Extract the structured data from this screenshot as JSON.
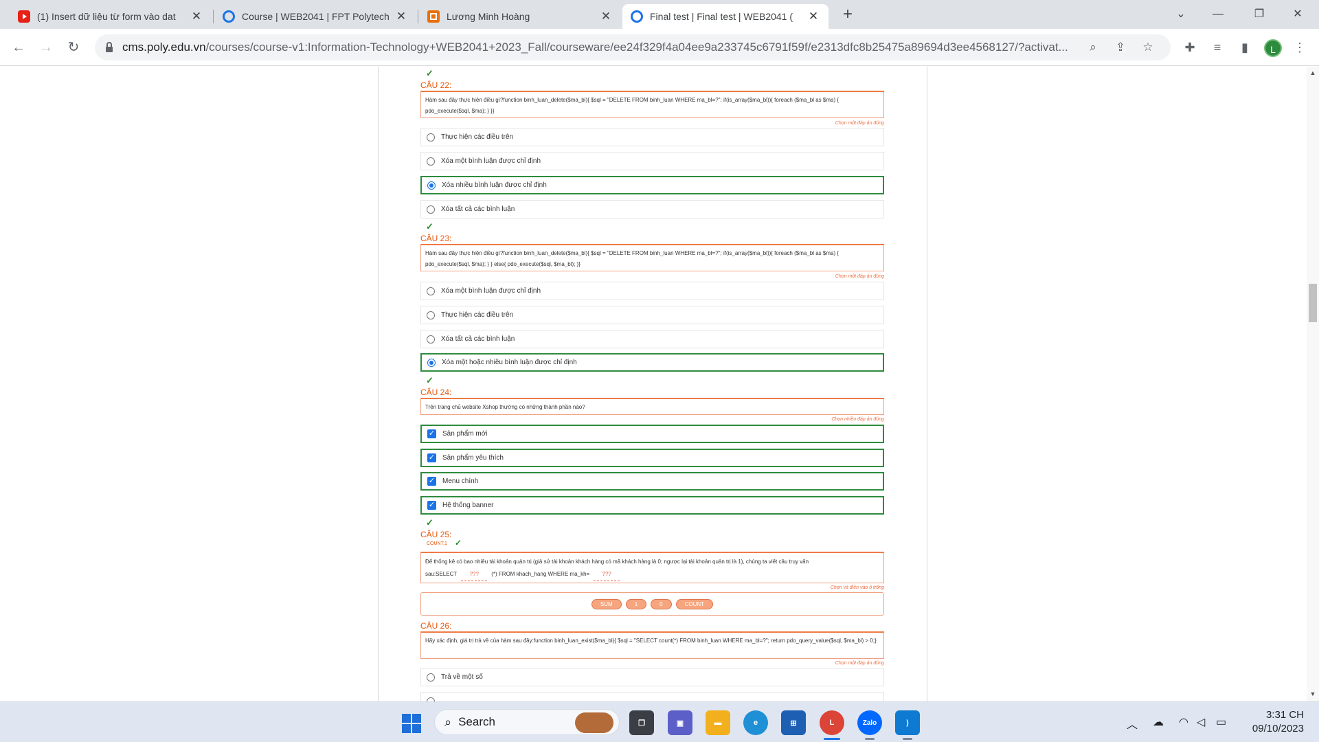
{
  "browser": {
    "tabs": [
      {
        "title": "(1) Insert dữ liệu từ form vào dat",
        "favicon": "youtube-icon"
      },
      {
        "title": "Course | WEB2041 | FPT Polytech",
        "favicon": "course-ring-icon"
      },
      {
        "title": "Lương Minh Hoàng",
        "favicon": "box-icon"
      },
      {
        "title": "Final test | Final test | WEB2041 (",
        "favicon": "course-ring-icon"
      }
    ],
    "url_host": "cms.poly.edu.vn",
    "url_path": "/courses/course-v1:Information-Technology+WEB2041+2023_Fall/courseware/ee24f329f4a04ee9a233745c6791f59f/e2313dfc8b25475a89694d3ee4568127/?activat...",
    "profile_initial": "L"
  },
  "quiz": {
    "q22": {
      "title": "CÂU 22:",
      "text": "Hàm sau đây thực hiện điều gì?function binh_luan_delete($ma_bl){ $sql = \"DELETE FROM binh_luan WHERE ma_bl=?\"; if(is_array($ma_bl)){ foreach ($ma_bl as $ma) { pdo_execute($sql, $ma); } }}",
      "hint": "Chọn một đáp án đúng",
      "options": [
        "Thực hiện các điều trên",
        "Xóa một bình luận được chỉ định",
        "Xóa nhiều bình luận được chỉ định",
        "Xóa tất cả các bình luận"
      ],
      "selected": 2
    },
    "q23": {
      "title": "CÂU 23:",
      "text": "Hàm sau đây thực hiện điều gì?function binh_luan_delete($ma_bl){ $sql = \"DELETE FROM binh_luan WHERE ma_bl=?\"; if(is_array($ma_bl)){ foreach ($ma_bl as $ma) { pdo_execute($sql, $ma); } } else{ pdo_execute($sql, $ma_bl); }}",
      "hint": "Chọn một đáp án đúng",
      "options": [
        "Xóa một bình luận được chỉ định",
        "Thực hiện các điều trên",
        "Xóa tất cả các bình luận",
        "Xóa một hoặc nhiều bình luận được chỉ định"
      ],
      "selected": 3
    },
    "q24": {
      "title": "CÂU 24:",
      "text": "Trên trang chủ website Xshop thường có những thành phần nào?",
      "hint": "Chọn nhiều đáp án đúng",
      "options": [
        "Sản phẩm mới",
        "Sản phẩm yêu thích",
        "Menu chính",
        "Hệ thống banner"
      ]
    },
    "q25": {
      "title": "CÂU 25:",
      "answered": "COUNT,1",
      "text_a": "Để thống kê có bao nhiêu tài khoản quản trị (giả sử tài khoản khách hàng có mã khách hàng là 0; ngược lại tài khoản quản trị là 1), chúng ta viết câu truy vấn",
      "text_b": "sau:SELECT",
      "blank1": "???",
      "text_c": "(*) FROM khach_hang WHERE ma_kh=",
      "blank2": "???",
      "hint": "Chọn và điền vào ô trống",
      "chips": [
        "SUM",
        "1",
        "0",
        "COUNT"
      ]
    },
    "q26": {
      "title": "CÂU 26:",
      "text": "Hãy xác định, giá trị trả về của hàm sau đây:function binh_luan_exist($ma_bl){ $sql = \"SELECT count(*) FROM binh_luan WHERE ma_bl=?\"; return pdo_query_value($sql, $ma_bl) > 0;}",
      "hint": "Chọn một đáp án đúng",
      "options": [
        "Trả về một số"
      ]
    }
  },
  "taskbar": {
    "search_label": "Search",
    "time": "3:31 CH",
    "date": "09/10/2023",
    "chrome_badge": "L",
    "zalo_label": "Zalo"
  }
}
